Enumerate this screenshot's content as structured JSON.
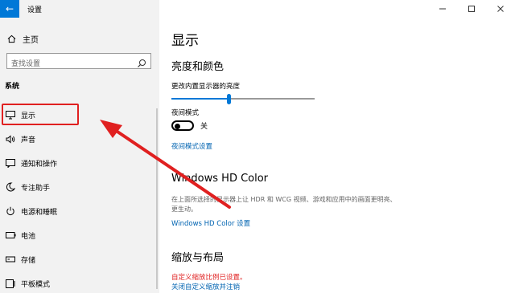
{
  "window": {
    "title": "设置",
    "back_icon": "back-arrow-icon",
    "minimize_icon": "minimize-icon",
    "maximize_icon": "maximize-icon",
    "close_icon": "close-icon"
  },
  "sidebar": {
    "home_label": "主页",
    "search_placeholder": "查找设置",
    "section_label": "系统",
    "items": [
      {
        "label": "显示",
        "icon": "monitor-icon"
      },
      {
        "label": "声音",
        "icon": "speaker-icon"
      },
      {
        "label": "通知和操作",
        "icon": "notification-icon"
      },
      {
        "label": "专注助手",
        "icon": "moon-icon"
      },
      {
        "label": "电源和睡眠",
        "icon": "power-icon"
      },
      {
        "label": "电池",
        "icon": "battery-icon"
      },
      {
        "label": "存储",
        "icon": "storage-icon"
      },
      {
        "label": "平板模式",
        "icon": "tablet-icon"
      }
    ],
    "selected_index": 0
  },
  "main": {
    "page_title": "显示",
    "brightness_section": "亮度和颜色",
    "brightness_label": "更改内置显示器的亮度",
    "brightness_value": 0.4,
    "night_mode_label": "夜间模式",
    "night_mode_state": "关",
    "night_mode_link": "夜间模式设置",
    "hdr_title": "Windows HD Color",
    "hdr_desc": "在上面所选择的显示器上让 HDR 和 WCG 视频、游戏和应用中的画面更明亮、更生动。",
    "hdr_link": "Windows HD Color 设置",
    "scale_section": "缩放与布局",
    "scale_warning": "自定义缩放比例已设置。",
    "scale_link": "关闭自定义缩放并注销"
  },
  "colors": {
    "accent": "#0078d7",
    "highlight_red": "#e02020",
    "link": "#0063b1"
  }
}
